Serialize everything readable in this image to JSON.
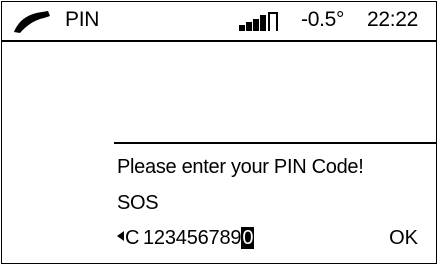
{
  "status_bar": {
    "call_icon": "phone-handset-icon",
    "title": "PIN",
    "signal_icon": "signal-strength-icon",
    "temperature": "-0.5°",
    "time": "22:22"
  },
  "dialog": {
    "prompt": "Please enter your PIN Code!",
    "sos_label": "SOS",
    "backspace_label": "C",
    "entered_digits": "123456789",
    "cursor_digit": "0",
    "ok_label": "OK"
  }
}
